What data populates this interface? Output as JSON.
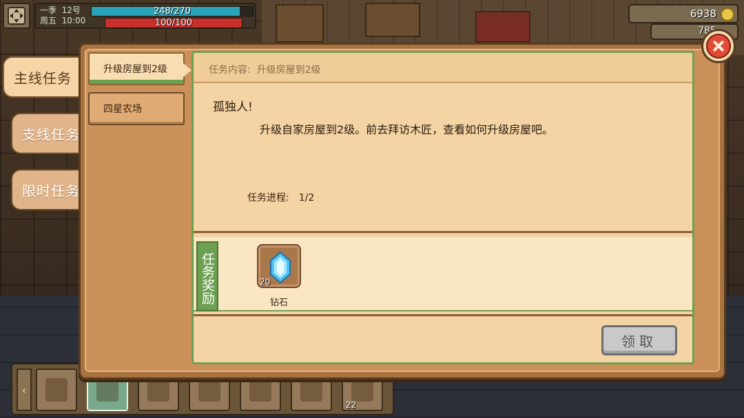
{
  "hud": {
    "season_label": "一季",
    "day_label": "12号",
    "weekday_label": "周五",
    "time_label": "10:00",
    "stamina_text": "248/270",
    "stamina_fraction": 0.9185,
    "health_text": "100/100",
    "health_fraction": 1.0,
    "money": "6938",
    "gems": "785",
    "stamina_color": "#2aa3b8",
    "health_color": "#c9302c"
  },
  "side_tabs": [
    {
      "label": "主线任务",
      "active": true
    },
    {
      "label": "支线任务",
      "active": false
    },
    {
      "label": "限时任务",
      "active": false
    }
  ],
  "quest_list": [
    {
      "label": "升级房屋到2级",
      "active": true
    },
    {
      "label": "四星农场",
      "active": false
    }
  ],
  "detail": {
    "header_label": "任务内容:",
    "header_value": "升级房屋到2级",
    "title": "孤独人!",
    "description": "升级自家房屋到2级。前去拜访木匠，查看如何升级房屋吧。",
    "progress_label": "任务进程:",
    "progress_value": "1/2",
    "reward_label": "任务奖励",
    "rewards": [
      {
        "name": "钻石",
        "count": "20",
        "icon": "diamond-icon"
      }
    ],
    "claim_button": "领取"
  },
  "hotbar": {
    "slots": [
      {
        "icon": "backpack-icon",
        "count": ""
      },
      {
        "icon": "sword-icon",
        "count": ""
      },
      {
        "icon": "axe-icon",
        "count": ""
      },
      {
        "icon": "pickaxe-icon",
        "count": ""
      },
      {
        "icon": "hoe-icon",
        "count": ""
      },
      {
        "icon": "axe-icon",
        "count": ""
      },
      {
        "icon": "wood-icon",
        "count": "22"
      }
    ]
  },
  "colors": {
    "accent_green": "#6ea052",
    "panel_bg": "#f4d3a4",
    "window_brown": "#a8733f",
    "close_red": "#e24a36"
  }
}
